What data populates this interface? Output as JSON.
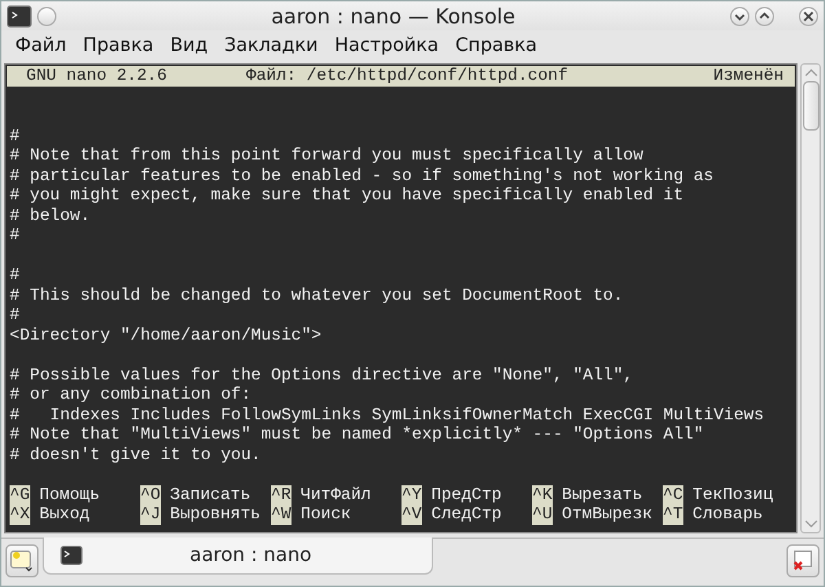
{
  "window": {
    "title": "aaron : nano — Konsole"
  },
  "menu": [
    "Файл",
    "Правка",
    "Вид",
    "Закладки",
    "Настройка",
    "Справка"
  ],
  "nano_header": {
    "version": "GNU nano 2.2.6",
    "file": "Файл: /etc/httpd/conf/httpd.conf",
    "status": "Изменён"
  },
  "blocks": [
    [
      "#",
      "# Note that from this point forward you must specifically allow",
      "# particular features to be enabled - so if something's not working as",
      "# you might expect, make sure that you have specifically enabled it",
      "# below.",
      "#"
    ],
    [
      "#",
      "# This should be changed to whatever you set DocumentRoot to.",
      "#",
      "<Directory \"/home/aaron/Music\">"
    ],
    [
      "# Possible values for the Options directive are \"None\", \"All\",",
      "# or any combination of:",
      "#   Indexes Includes FollowSymLinks SymLinksifOwnerMatch ExecCGI MultiViews",
      "# Note that \"MultiViews\" must be named *explicitly* --- \"Options All\"",
      "# doesn't give it to you."
    ]
  ],
  "shortcuts": [
    [
      {
        "key": "^G",
        "label": "Помощь"
      },
      {
        "key": "^O",
        "label": "Записать"
      },
      {
        "key": "^R",
        "label": "ЧитФайл"
      },
      {
        "key": "^Y",
        "label": "ПредСтр"
      },
      {
        "key": "^K",
        "label": "Вырезать"
      },
      {
        "key": "^C",
        "label": "ТекПозиц"
      }
    ],
    [
      {
        "key": "^X",
        "label": "Выход"
      },
      {
        "key": "^J",
        "label": "Выровнять"
      },
      {
        "key": "^W",
        "label": "Поиск"
      },
      {
        "key": "^V",
        "label": "СледСтр"
      },
      {
        "key": "^U",
        "label": "ОтмВырезк"
      },
      {
        "key": "^T",
        "label": "Словарь"
      }
    ]
  ],
  "tabs": [
    {
      "label": "aaron : nano",
      "selected": true
    }
  ]
}
